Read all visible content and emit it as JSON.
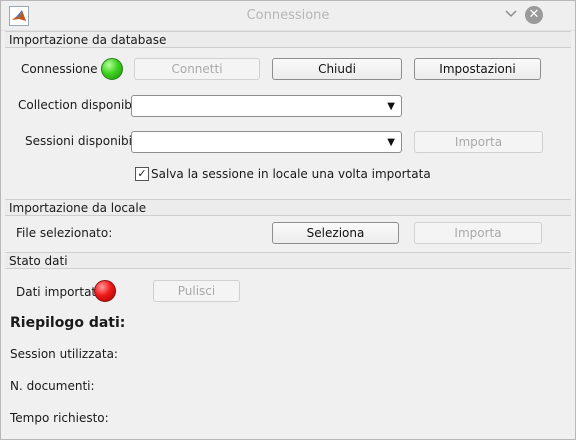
{
  "window": {
    "title": "Connessione"
  },
  "db_import": {
    "section_title": "Importazione da database",
    "connection_label": "Connessione",
    "connect_button": "Connetti",
    "close_button": "Chiudi",
    "settings_button": "Impostazioni",
    "collections_label": "Collection disponibili",
    "collections_value": "",
    "sessions_label": "Sessioni disponibili",
    "sessions_value": "",
    "import_button": "Importa",
    "save_locally_checked": true,
    "save_locally_label": "Salva la sessione in locale una volta importata"
  },
  "local_import": {
    "section_title": "Importazione da locale",
    "file_label": "File selezionato:",
    "select_button": "Seleziona",
    "import_button": "Importa"
  },
  "data_status": {
    "section_title": "Stato dati",
    "imported_label": "Dati importati",
    "clear_button": "Pulisci"
  },
  "summary": {
    "title": "Riepilogo dati:",
    "session_label": "Session utilizzata:",
    "documents_label": "N. documenti:",
    "time_label": "Tempo richiesto:"
  },
  "status_colors": {
    "connected": "#3ed321",
    "imported": "#f01919"
  },
  "icons": {
    "app": "matlab-logo-icon",
    "minimize": "chevron-down-icon",
    "close": "close-icon"
  }
}
